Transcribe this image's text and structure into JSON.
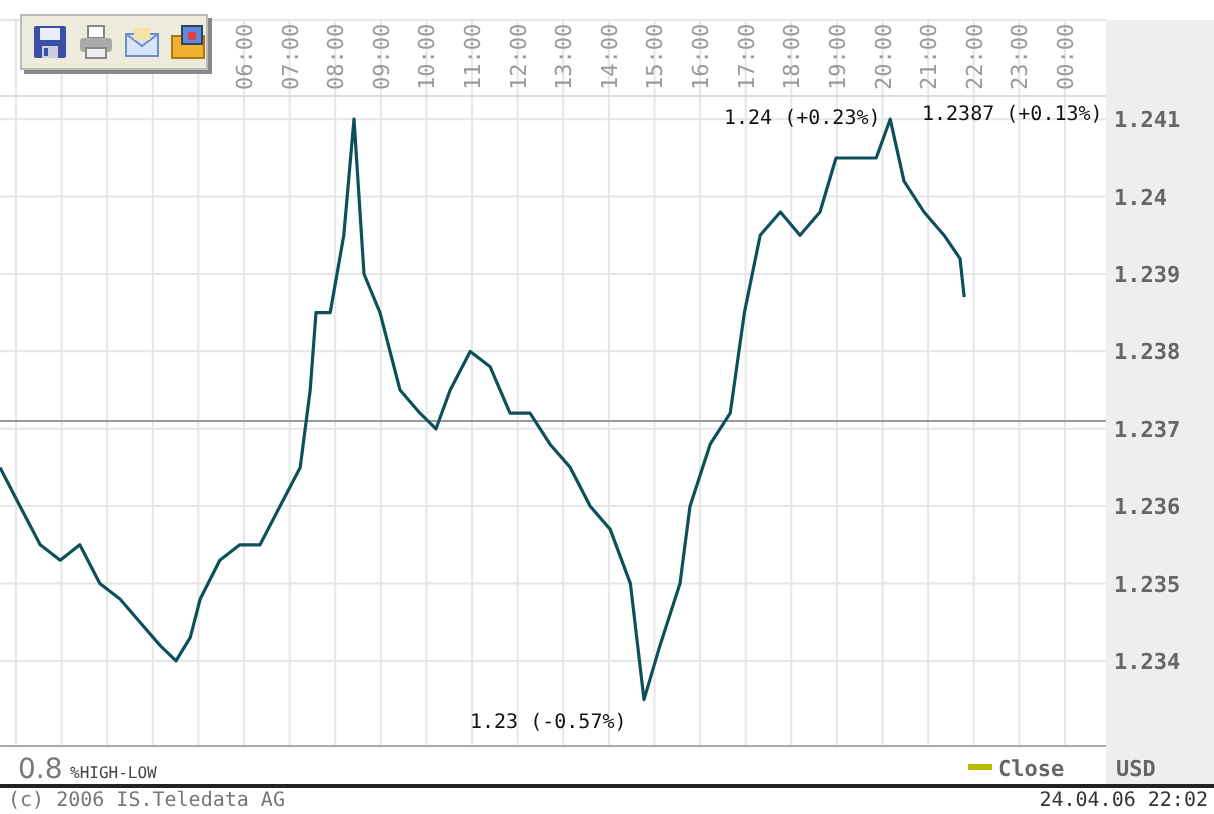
{
  "toolbar": {
    "buttons": [
      {
        "kind": "save"
      },
      {
        "kind": "print"
      },
      {
        "kind": "mail"
      },
      {
        "kind": "export"
      }
    ]
  },
  "chart": {
    "chart_data": {
      "type": "line",
      "grid": true,
      "xlim": [
        0.65,
        24.9
      ],
      "ylim": [
        1.2329,
        1.2413
      ],
      "xticks": [
        {
          "value": 6,
          "label": "06:00"
        },
        {
          "value": 7,
          "label": "07:00"
        },
        {
          "value": 8,
          "label": "08:00"
        },
        {
          "value": 9,
          "label": "09:00"
        },
        {
          "value": 10,
          "label": "10:00"
        },
        {
          "value": 11,
          "label": "11:00"
        },
        {
          "value": 12,
          "label": "12:00"
        },
        {
          "value": 13,
          "label": "13:00"
        },
        {
          "value": 14,
          "label": "14:00"
        },
        {
          "value": 15,
          "label": "15:00"
        },
        {
          "value": 16,
          "label": "16:00"
        },
        {
          "value": 17,
          "label": "17:00"
        },
        {
          "value": 18,
          "label": "18:00"
        },
        {
          "value": 19,
          "label": "19:00"
        },
        {
          "value": 20,
          "label": "20:00"
        },
        {
          "value": 21,
          "label": "21:00"
        },
        {
          "value": 22,
          "label": "22:00"
        },
        {
          "value": 23,
          "label": "23:00"
        },
        {
          "value": 24,
          "label": "00:00"
        }
      ],
      "yticks": [
        {
          "value": 1.234,
          "label": "1.234"
        },
        {
          "value": 1.235,
          "label": "1.235"
        },
        {
          "value": 1.236,
          "label": "1.236"
        },
        {
          "value": 1.237,
          "label": "1.237"
        },
        {
          "value": 1.238,
          "label": "1.238"
        },
        {
          "value": 1.239,
          "label": "1.239"
        },
        {
          "value": 1.24,
          "label": "1.24"
        },
        {
          "value": 1.241,
          "label": "1.241"
        }
      ],
      "x": [
        0.65,
        1.09,
        1.53,
        1.97,
        2.4,
        2.84,
        3.28,
        3.72,
        4.16,
        4.51,
        4.82,
        5.04,
        5.47,
        5.91,
        6.35,
        6.79,
        7.23,
        7.45,
        7.58,
        7.89,
        8.19,
        8.41,
        8.63,
        8.98,
        9.42,
        9.86,
        10.21,
        10.52,
        10.96,
        11.4,
        11.83,
        12.27,
        12.71,
        13.15,
        13.59,
        14.03,
        14.47,
        14.77,
        15.12,
        15.56,
        15.78,
        16.22,
        16.66,
        16.97,
        17.32,
        17.76,
        18.19,
        18.63,
        18.98,
        19.42,
        19.86,
        20.17,
        20.47,
        20.91,
        21.35,
        21.7,
        21.79
      ],
      "series": [
        {
          "name": "Close",
          "color": "#0d4f5a",
          "values": [
            1.2365,
            1.236,
            1.2355,
            1.2353,
            1.2355,
            1.235,
            1.2348,
            1.2345,
            1.2342,
            1.234,
            1.2343,
            1.2348,
            1.2353,
            1.2355,
            1.2355,
            1.236,
            1.2365,
            1.2375,
            1.2385,
            1.2385,
            1.2395,
            1.241,
            1.239,
            1.2385,
            1.2375,
            1.2372,
            1.237,
            1.2375,
            1.238,
            1.2378,
            1.2372,
            1.2372,
            1.2368,
            1.2365,
            1.236,
            1.2357,
            1.235,
            1.2335,
            1.2342,
            1.235,
            1.236,
            1.2368,
            1.2372,
            1.2385,
            1.2395,
            1.2398,
            1.2395,
            1.2398,
            1.2405,
            1.2405,
            1.2405,
            1.241,
            1.2402,
            1.2398,
            1.2395,
            1.2392,
            1.2387
          ]
        }
      ],
      "ref_lines": [
        {
          "axis": "y",
          "value": 1.2371
        }
      ],
      "annotations": [
        "1.24 (+0.23%)",
        "1.2387 (+0.13%)",
        "1.23 (-0.57%)"
      ]
    }
  },
  "legend": {
    "range_value": "0.8",
    "range_label": "%HIGH-LOW",
    "currency": "USD"
  },
  "footer": {
    "copyright": "(c) 2006 IS.Teledata AG",
    "timestamp": "24.04.06 22:02"
  }
}
